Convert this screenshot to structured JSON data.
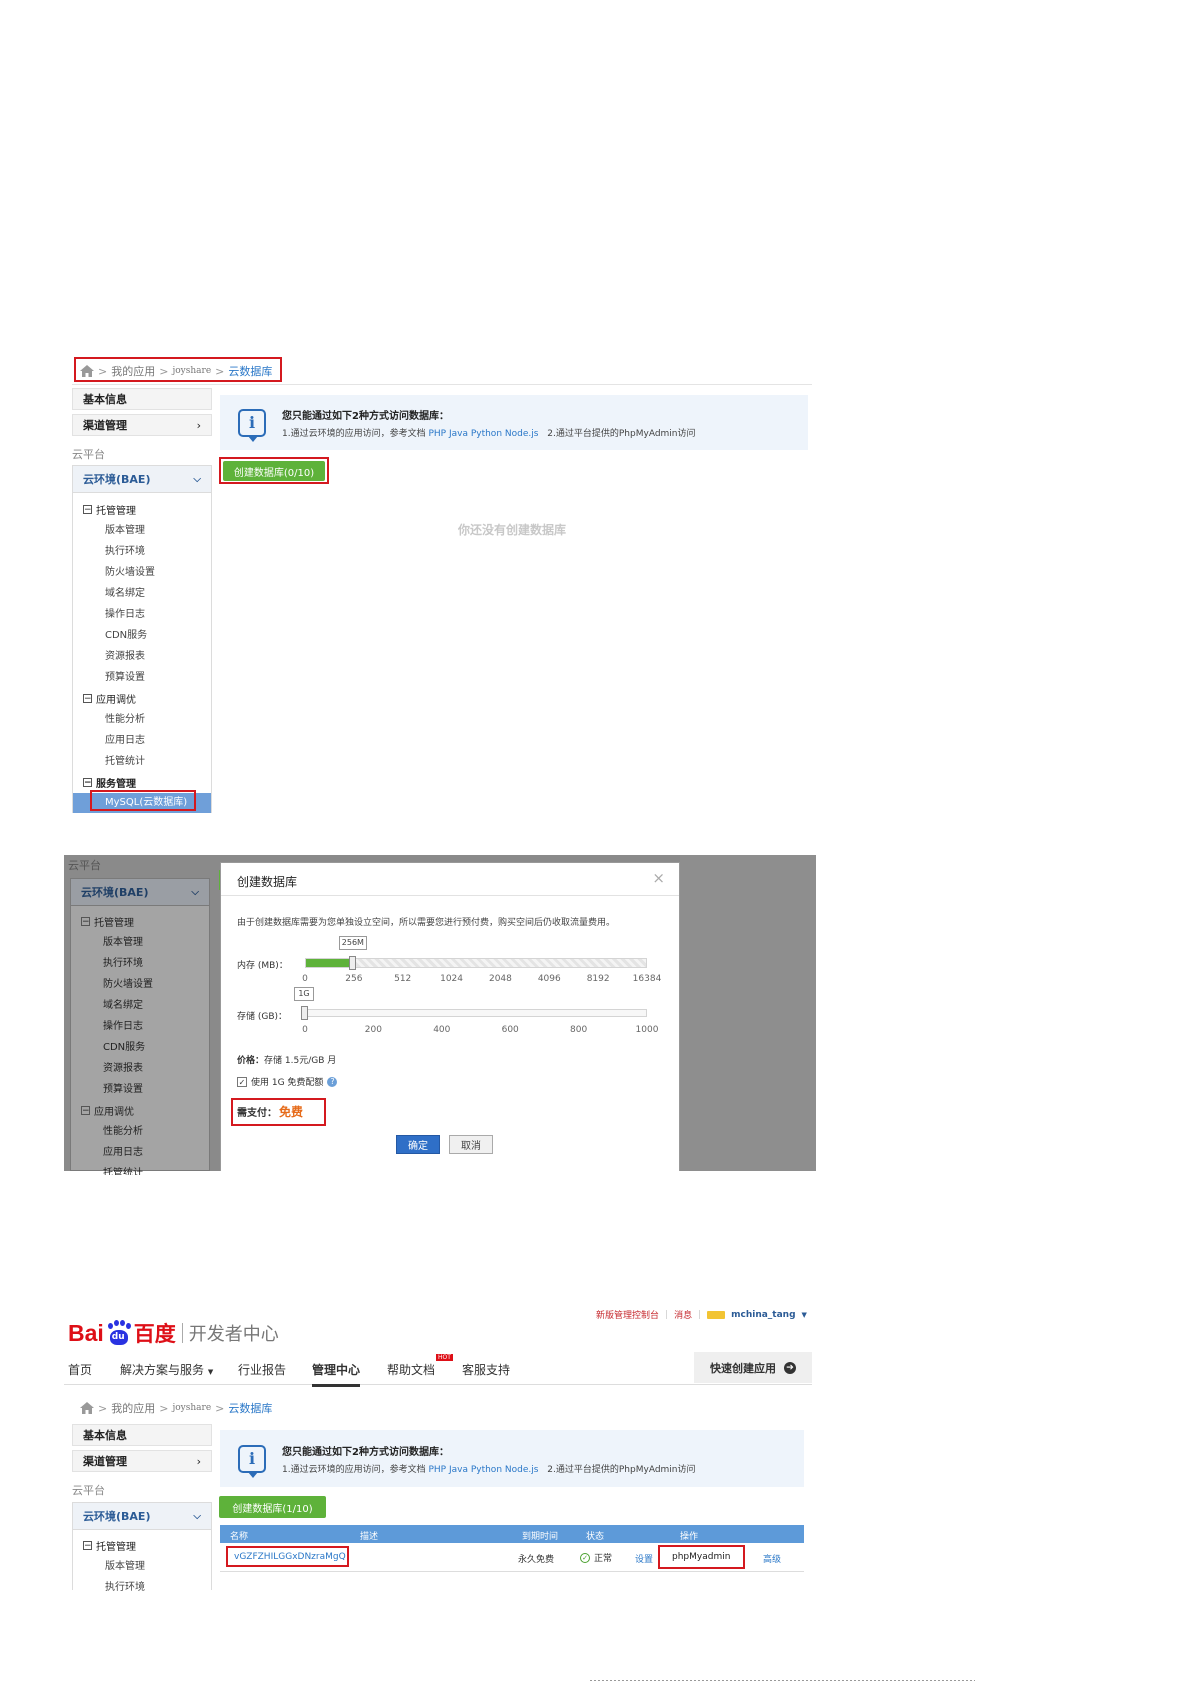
{
  "s1": {
    "breadcrumb": {
      "my_apps": "我的应用",
      "app": "joyshare",
      "current": "云数据库"
    },
    "sidebar": {
      "basic": "基本信息",
      "channel": "渠道管理",
      "section": "云平台",
      "env": "云环境(BAE)",
      "groups": [
        {
          "title": "托管管理",
          "items": [
            "版本管理",
            "执行环境",
            "防火墙设置",
            "域名绑定",
            "操作日志",
            "CDN服务",
            "资源报表",
            "预算设置"
          ]
        },
        {
          "title": "应用调优",
          "items": [
            "性能分析",
            "应用日志",
            "托管统计"
          ]
        },
        {
          "title": "服务管理",
          "items": [
            "MySQL(云数据库)"
          ]
        }
      ]
    },
    "info": {
      "title": "您只能通过如下2种方式访问数据库：",
      "line_a": "1.通过云环境的应用访问，参考文档",
      "links": "PHP Java Python Node.js",
      "line_b": "2.通过平台提供的PhpMyAdmin访问"
    },
    "create_btn": "创建数据库(0/10)",
    "empty": "你还没有创建数据库"
  },
  "s2": {
    "sidebar": {
      "section": "云平台",
      "env": "云环境(BAE)",
      "group1": "托管管理",
      "items1": [
        "版本管理",
        "执行环境",
        "防火墙设置",
        "域名绑定",
        "操作日志",
        "CDN服务",
        "资源报表",
        "预算设置"
      ],
      "group2": "应用调优",
      "items2": [
        "性能分析",
        "应用日志",
        "托管统计"
      ]
    },
    "dialog": {
      "title": "创建数据库",
      "close": "×",
      "desc": "由于创建数据库需要为您单独设立空间，所以需要您进行预付费，购买空间后仍收取流量费用。",
      "mem_label": "内存 (MB)：",
      "mem_value": "256M",
      "mem_ticks": [
        "0",
        "256",
        "512",
        "1024",
        "2048",
        "4096",
        "8192",
        "16384"
      ],
      "mem_fraction": 0.14,
      "store_label": "存储 (GB)：",
      "store_value": "1G",
      "store_ticks": [
        "0",
        "200",
        "400",
        "600",
        "800",
        "1000"
      ],
      "price_label": "价格：",
      "price_text": "存储 1.5元/GB 月",
      "free_quota": "使用 1G 免费配额",
      "pay_label": "需支付：",
      "pay_value": "免费",
      "ok": "确定",
      "cancel": "取消"
    }
  },
  "s3": {
    "logo": {
      "mark": "Bai",
      "paw": "du",
      "cn": "百度",
      "suffix": "开发者中心"
    },
    "top_links": {
      "console": "新版管理控制台",
      "messages": "消息",
      "user": "mchina_tang"
    },
    "nav": {
      "home": "首页",
      "solutions": "解决方案与服务",
      "reports": "行业报告",
      "manage": "管理中心",
      "docs": "帮助文档",
      "hot": "HOT",
      "support": "客服支持",
      "quick": "快速创建应用"
    },
    "breadcrumb": {
      "my_apps": "我的应用",
      "app": "joyshare",
      "current": "云数据库"
    },
    "sidebar": {
      "basic": "基本信息",
      "channel": "渠道管理",
      "section": "云平台",
      "env": "云环境(BAE)",
      "group": "托管管理",
      "items": [
        "版本管理",
        "执行环境"
      ]
    },
    "info": {
      "title": "您只能通过如下2种方式访问数据库：",
      "line_a": "1.通过云环境的应用访问，参考文档",
      "links": "PHP Java Python Node.js",
      "line_b": "2.通过平台提供的PhpMyAdmin访问"
    },
    "create_btn": "创建数据库(1/10)",
    "table": {
      "headers": [
        "名称",
        "描述",
        "到期时间",
        "状态",
        "操作"
      ],
      "row": {
        "name": "vGZFZHILGGxDNzraMgQ",
        "desc": "",
        "expire": "永久免费",
        "status": "正常",
        "settings": "设置",
        "phpmyadmin": "phpMyadmin",
        "advanced": "高级"
      }
    }
  },
  "colors": {
    "accent_red": "#d4191f",
    "link_blue": "#2b78c8",
    "green": "#5eb23a",
    "baidu_red": "#de0f17",
    "baidu_blue": "#2932e1"
  }
}
